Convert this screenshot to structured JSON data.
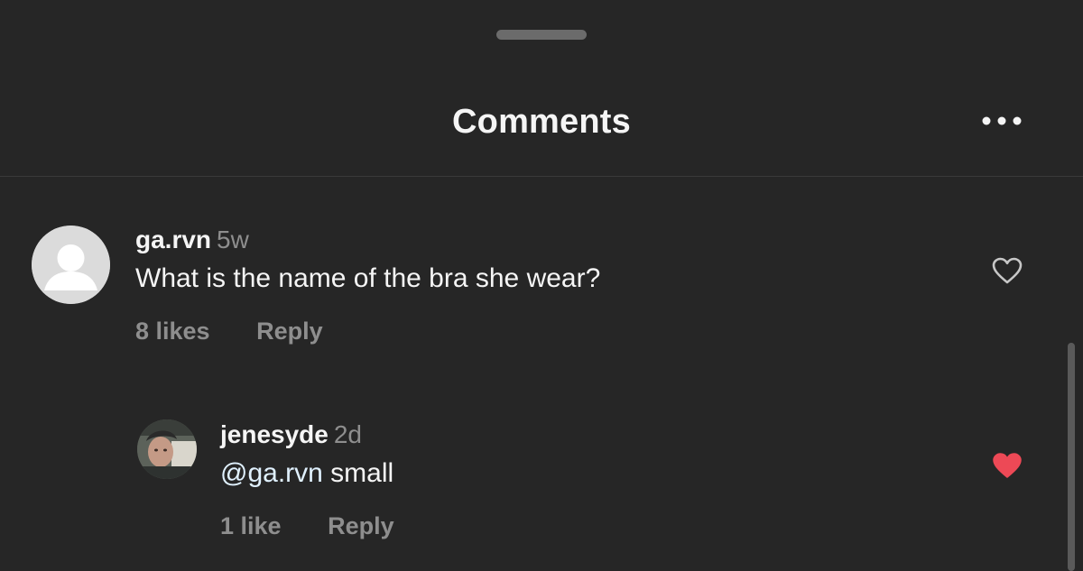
{
  "header": {
    "title": "Comments",
    "more_icon": "more-horizontal-icon"
  },
  "comments": [
    {
      "avatar": "default-avatar",
      "username": "ga.rvn",
      "time": "5w",
      "text": "What is the name of the bra she wear?",
      "likes": "8 likes",
      "reply": "Reply",
      "liked": false,
      "heart_icon": "heart-outline-icon"
    }
  ],
  "replies": [
    {
      "avatar": "user-photo-avatar",
      "username": "jenesyde",
      "time": "2d",
      "mention": "@ga.rvn",
      "text": " small",
      "likes": "1 like",
      "reply": "Reply",
      "liked": true,
      "heart_icon": "heart-filled-icon"
    }
  ],
  "colors": {
    "background": "#262626",
    "text_primary": "#f5f5f5",
    "text_secondary": "#8e8e8e",
    "mention": "#e0f1ff",
    "liked_heart": "#ed4956"
  }
}
